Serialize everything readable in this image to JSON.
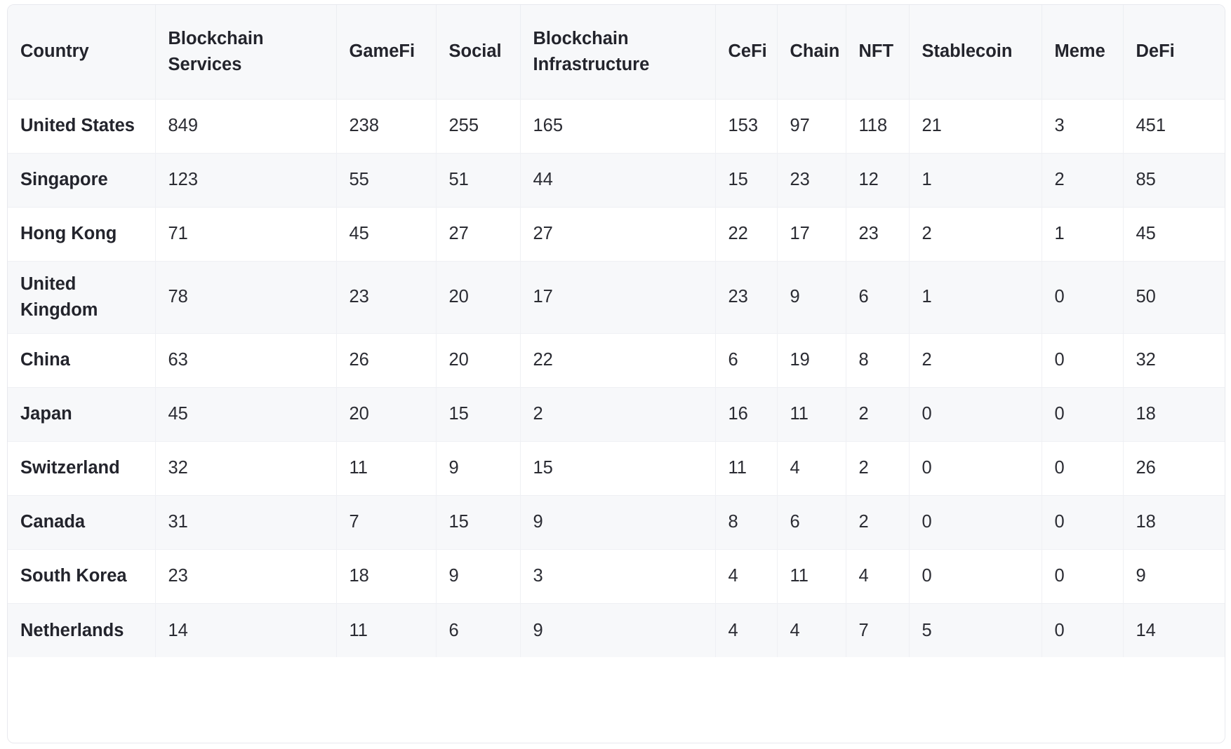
{
  "table": {
    "columns": [
      "Country",
      "Blockchain Services",
      "GameFi",
      "Social",
      "Blockchain Infrastructure",
      "CeFi",
      "Chain",
      "NFT",
      "Stablecoin",
      "Meme",
      "DeFi"
    ],
    "rows": [
      {
        "country": "United States",
        "values": [
          "849",
          "238",
          "255",
          "165",
          "153",
          "97",
          "118",
          "21",
          "3",
          "451"
        ]
      },
      {
        "country": "Singapore",
        "values": [
          "123",
          "55",
          "51",
          "44",
          "15",
          "23",
          "12",
          "1",
          "2",
          "85"
        ]
      },
      {
        "country": "Hong Kong",
        "values": [
          "71",
          "45",
          "27",
          "27",
          "22",
          "17",
          "23",
          "2",
          "1",
          "45"
        ]
      },
      {
        "country": "United Kingdom",
        "values": [
          "78",
          "23",
          "20",
          "17",
          "23",
          "9",
          "6",
          "1",
          "0",
          "50"
        ]
      },
      {
        "country": "China",
        "values": [
          "63",
          "26",
          "20",
          "22",
          "6",
          "19",
          "8",
          "2",
          "0",
          "32"
        ]
      },
      {
        "country": "Japan",
        "values": [
          "45",
          "20",
          "15",
          "2",
          "16",
          "11",
          "2",
          "0",
          "0",
          "18"
        ]
      },
      {
        "country": "Switzerland",
        "values": [
          "32",
          "11",
          "9",
          "15",
          "11",
          "4",
          "2",
          "0",
          "0",
          "26"
        ]
      },
      {
        "country": "Canada",
        "values": [
          "31",
          "7",
          "15",
          "9",
          "8",
          "6",
          "2",
          "0",
          "0",
          "18"
        ]
      },
      {
        "country": "South Korea",
        "values": [
          "23",
          "18",
          "9",
          "3",
          "4",
          "11",
          "4",
          "0",
          "0",
          "9"
        ]
      },
      {
        "country": "Netherlands",
        "values": [
          "14",
          "11",
          "6",
          "9",
          "4",
          "4",
          "7",
          "5",
          "0",
          "14"
        ]
      }
    ]
  },
  "chart_data": {
    "type": "table",
    "title": "",
    "columns": [
      "Country",
      "Blockchain Services",
      "GameFi",
      "Social",
      "Blockchain Infrastructure",
      "CeFi",
      "Chain",
      "NFT",
      "Stablecoin",
      "Meme",
      "DeFi"
    ],
    "rows": [
      [
        "United States",
        849,
        238,
        255,
        165,
        153,
        97,
        118,
        21,
        3,
        451
      ],
      [
        "Singapore",
        123,
        55,
        51,
        44,
        15,
        23,
        12,
        1,
        2,
        85
      ],
      [
        "Hong Kong",
        71,
        45,
        27,
        27,
        22,
        17,
        23,
        2,
        1,
        45
      ],
      [
        "United Kingdom",
        78,
        23,
        20,
        17,
        23,
        9,
        6,
        1,
        0,
        50
      ],
      [
        "China",
        63,
        26,
        20,
        22,
        6,
        19,
        8,
        2,
        0,
        32
      ],
      [
        "Japan",
        45,
        20,
        15,
        2,
        16,
        11,
        2,
        0,
        0,
        18
      ],
      [
        "Switzerland",
        32,
        11,
        9,
        15,
        11,
        4,
        2,
        0,
        0,
        26
      ],
      [
        "Canada",
        31,
        7,
        15,
        9,
        8,
        6,
        2,
        0,
        0,
        18
      ],
      [
        "South Korea",
        23,
        18,
        9,
        3,
        4,
        11,
        4,
        0,
        0,
        9
      ],
      [
        "Netherlands",
        14,
        11,
        6,
        9,
        4,
        4,
        7,
        5,
        0,
        14
      ]
    ]
  },
  "colors": {
    "header_background": "#f7f8fa",
    "row_stripe": "#f7f8fa",
    "row_base": "#ffffff",
    "border": "#eceef2",
    "text": "#23242c"
  }
}
